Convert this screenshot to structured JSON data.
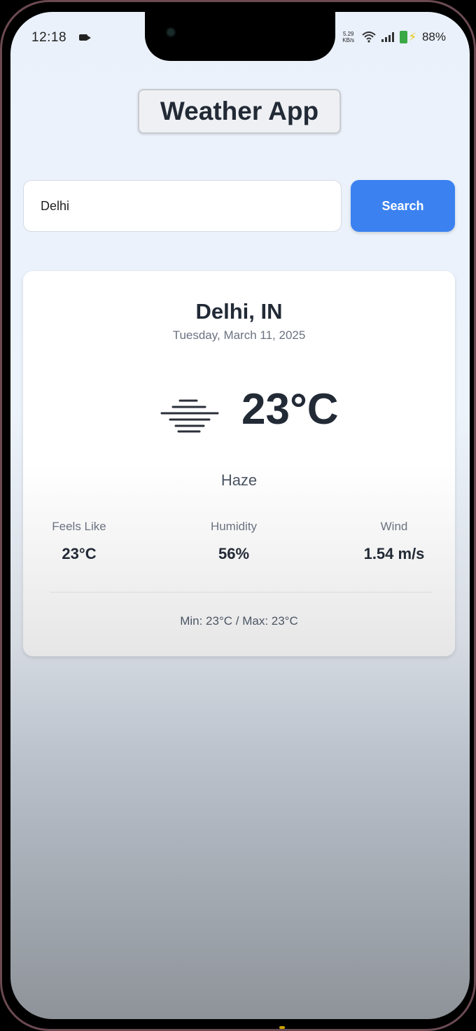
{
  "status_bar": {
    "time": "12:18",
    "net_speed": "5.29 KB/s",
    "battery": "88%",
    "icons": [
      "video-camera-icon",
      "wifi-icon",
      "signal-icon",
      "battery-icon",
      "charging-bolt-icon"
    ]
  },
  "app": {
    "title": "Weather App"
  },
  "search": {
    "value": "Delhi",
    "button_label": "Search"
  },
  "weather": {
    "city": "Delhi, IN",
    "date": "Tuesday, March 11, 2025",
    "temperature": "23°C",
    "condition": "Haze",
    "icon": "haze-icon",
    "feels_like_label": "Feels Like",
    "feels_like_value": "23°C",
    "humidity_label": "Humidity",
    "humidity_value": "56%",
    "wind_label": "Wind",
    "wind_value": "1.54 m/s",
    "min_max": "Min: 23°C / Max: 23°C"
  },
  "colors": {
    "accent": "#3b82f0",
    "text_dark": "#222a36",
    "text_muted": "#6b7280",
    "battery": "#3aa845"
  }
}
